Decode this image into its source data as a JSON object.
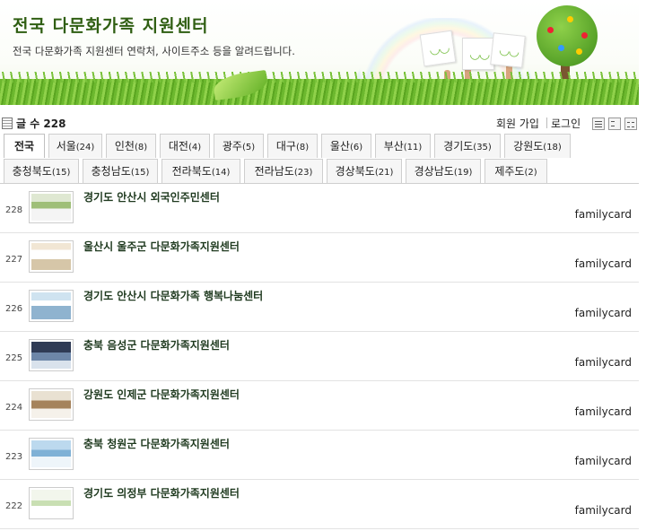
{
  "banner": {
    "title": "전국  다문화가족  지원센터",
    "subtitle": "전국 다문화가족 지원센터 연락처, 사이트주소 등을 알려드립니다."
  },
  "toolbar": {
    "count_label": "글 수 228",
    "join_label": "회원 가입",
    "login_label": "로그인"
  },
  "tabs": [
    {
      "label": "전국",
      "count": ""
    },
    {
      "label": "서울",
      "count": "(24)"
    },
    {
      "label": "인천",
      "count": "(8)"
    },
    {
      "label": "대전",
      "count": "(4)"
    },
    {
      "label": "광주",
      "count": "(5)"
    },
    {
      "label": "대구",
      "count": "(8)"
    },
    {
      "label": "울산",
      "count": "(6)"
    },
    {
      "label": "부산",
      "count": "(11)"
    },
    {
      "label": "경기도",
      "count": "(35)"
    },
    {
      "label": "강원도",
      "count": "(18)"
    },
    {
      "label": "충청북도",
      "count": "(15)"
    },
    {
      "label": "충청남도",
      "count": "(15)"
    },
    {
      "label": "전라북도",
      "count": "(14)"
    },
    {
      "label": "전라남도",
      "count": "(23)"
    },
    {
      "label": "경상북도",
      "count": "(21)"
    },
    {
      "label": "경상남도",
      "count": "(19)"
    },
    {
      "label": "제주도",
      "count": "(2)"
    }
  ],
  "posts": [
    {
      "num": "228",
      "title": "경기도 안산시 외국인주민센터",
      "author": "familycard"
    },
    {
      "num": "227",
      "title": "울산시 울주군 다문화가족지원센터",
      "author": "familycard"
    },
    {
      "num": "226",
      "title": "경기도 안산시 다문화가족 행복나눔센터",
      "author": "familycard"
    },
    {
      "num": "225",
      "title": "충북 음성군 다문화가족지원센터",
      "author": "familycard"
    },
    {
      "num": "224",
      "title": "강원도 인제군 다문화가족지원센터",
      "author": "familycard"
    },
    {
      "num": "223",
      "title": "충북 청원군 다문화가족지원센터",
      "author": "familycard"
    },
    {
      "num": "222",
      "title": "경기도 의정부 다문화가족지원센터",
      "author": "familycard"
    }
  ],
  "colors": {
    "title_green": "#2f5e12",
    "post_title": "#1f3a1f",
    "grass": "#6cb82e"
  }
}
